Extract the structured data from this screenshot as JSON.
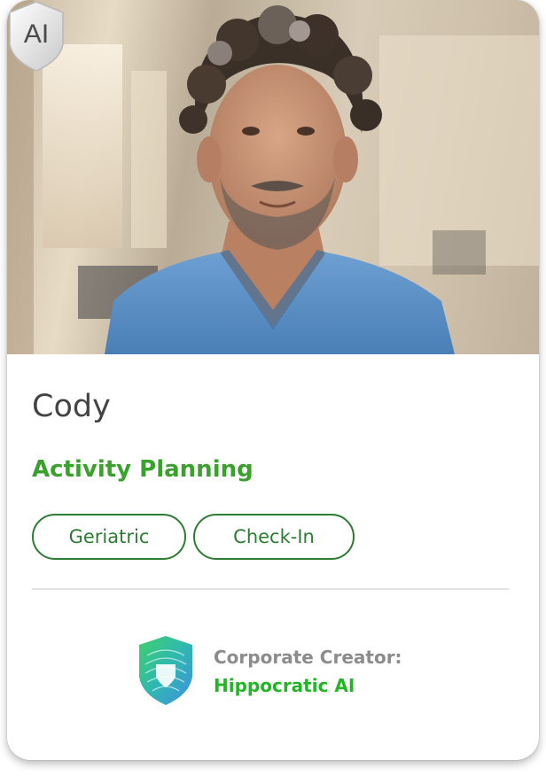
{
  "card": {
    "name": "Cody",
    "role": "Activity Planning",
    "tags": [
      "Geriatric",
      "Check-In"
    ],
    "badge_text": "AI",
    "creator_label": "Corporate Creator:",
    "creator_name": "Hippocratic AI"
  },
  "icons": {
    "ai_badge": "ai-shield-icon",
    "creator_logo": "hippocratic-shield-logo-icon"
  },
  "colors": {
    "role": "#3aa12d",
    "tag_border": "#2c7d31",
    "creator_name": "#22b526",
    "scrubs": "#5f93c9"
  }
}
